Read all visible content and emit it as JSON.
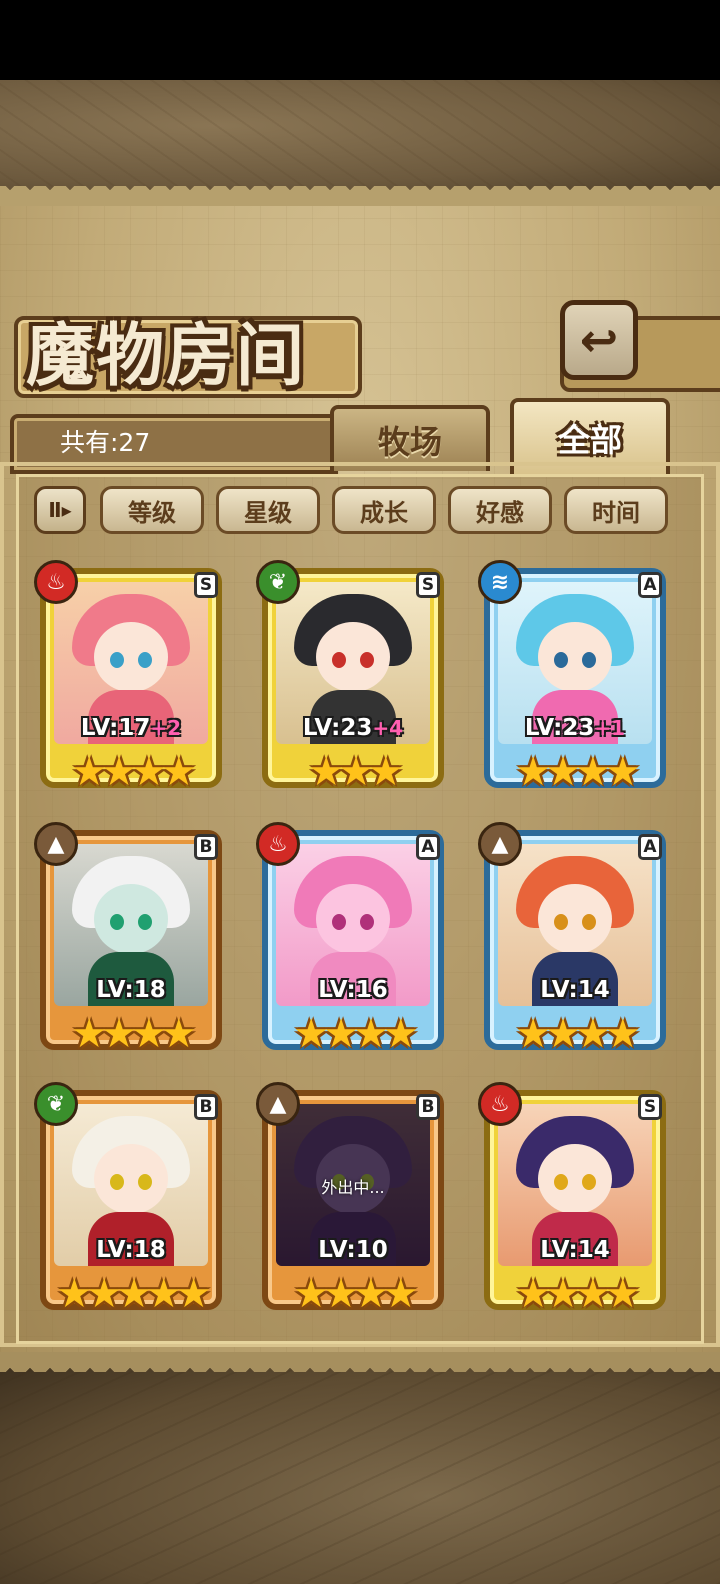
{
  "header": {
    "title": "魔物房间",
    "back_icon": "return-arrow-icon"
  },
  "summary": {
    "count_text": "共有:27"
  },
  "tabs": [
    {
      "label": "牧场",
      "active": false
    },
    {
      "label": "全部",
      "active": true
    }
  ],
  "sort": {
    "toggle_glyph": "Ⅱ▸",
    "options": [
      "等级",
      "星级",
      "成长",
      "好感",
      "时间"
    ]
  },
  "colors": {
    "gold_frame": "#f0d23a",
    "blue_frame": "#8fd0f0",
    "bronze_frame": "#e6963c",
    "fire": "#d22a25",
    "leaf": "#3a8f2c",
    "water": "#2a8ad0",
    "earth": "#7a5a3a",
    "star": "#ffc21a",
    "plus": "#ff5fb0"
  },
  "monsters": [
    {
      "element": "fire",
      "element_icon": "fire-icon",
      "rank": "S",
      "frame": "gold",
      "level": "LV:17",
      "plus": "+2",
      "stars": "★★★★",
      "status": ""
    },
    {
      "element": "leaf",
      "element_icon": "leaf-icon",
      "rank": "S",
      "frame": "gold",
      "level": "LV:23",
      "plus": "+4",
      "stars": "★★★",
      "status": ""
    },
    {
      "element": "water",
      "element_icon": "water-icon",
      "rank": "A",
      "frame": "blue",
      "level": "LV:23",
      "plus": "+1",
      "stars": "★★★★",
      "status": ""
    },
    {
      "element": "earth",
      "element_icon": "earth-icon",
      "rank": "B",
      "frame": "bronze",
      "level": "LV:18",
      "plus": "",
      "stars": "★★★★",
      "status": ""
    },
    {
      "element": "fire",
      "element_icon": "fire-icon",
      "rank": "A",
      "frame": "blue",
      "level": "LV:16",
      "plus": "",
      "stars": "★★★★",
      "status": ""
    },
    {
      "element": "earth",
      "element_icon": "earth-icon",
      "rank": "A",
      "frame": "blue",
      "level": "LV:14",
      "plus": "",
      "stars": "★★★★",
      "status": ""
    },
    {
      "element": "leaf",
      "element_icon": "leaf-icon",
      "rank": "B",
      "frame": "bronze",
      "level": "LV:18",
      "plus": "",
      "stars": "★★★★★",
      "status": ""
    },
    {
      "element": "earth",
      "element_icon": "earth-icon",
      "rank": "B",
      "frame": "bronze",
      "level": "LV:10",
      "plus": "",
      "stars": "★★★★",
      "status": "外出中..."
    },
    {
      "element": "fire",
      "element_icon": "fire-icon",
      "rank": "S",
      "frame": "gold",
      "level": "LV:14",
      "plus": "",
      "stars": "★★★★",
      "status": ""
    }
  ]
}
